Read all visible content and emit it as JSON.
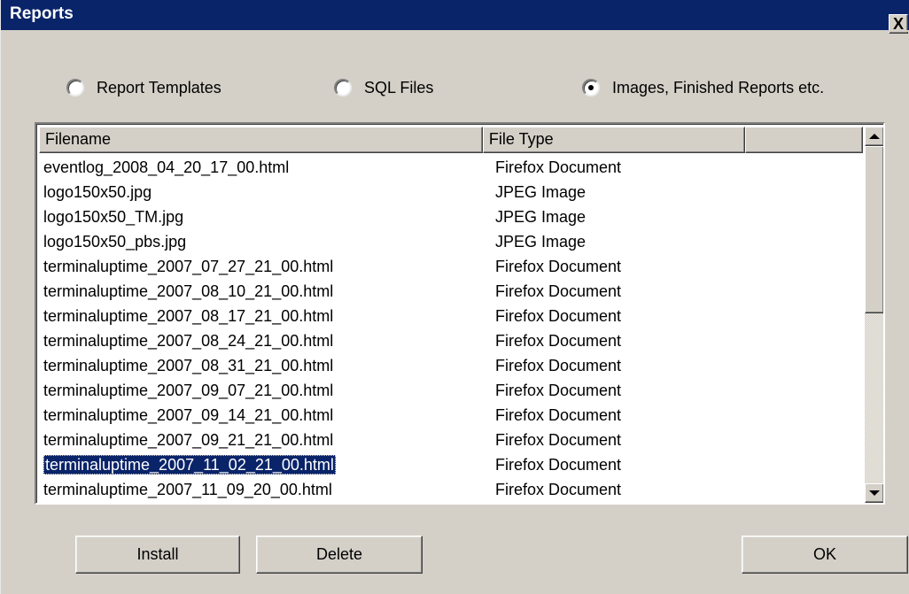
{
  "window": {
    "title": "Reports",
    "close_glyph": "X"
  },
  "radios": [
    {
      "label": "Report Templates",
      "checked": false
    },
    {
      "label": "SQL Files",
      "checked": false
    },
    {
      "label": "Images, Finished Reports etc.",
      "checked": true
    }
  ],
  "list": {
    "columns": [
      "Filename",
      "File Type",
      ""
    ],
    "rows": [
      {
        "name": "eventlog_2008_04_20_17_00.html",
        "type": "Firefox Document",
        "selected": false
      },
      {
        "name": "logo150x50.jpg",
        "type": "JPEG Image",
        "selected": false
      },
      {
        "name": "logo150x50_TM.jpg",
        "type": "JPEG Image",
        "selected": false
      },
      {
        "name": "logo150x50_pbs.jpg",
        "type": "JPEG Image",
        "selected": false
      },
      {
        "name": "terminaluptime_2007_07_27_21_00.html",
        "type": "Firefox Document",
        "selected": false
      },
      {
        "name": "terminaluptime_2007_08_10_21_00.html",
        "type": "Firefox Document",
        "selected": false
      },
      {
        "name": "terminaluptime_2007_08_17_21_00.html",
        "type": "Firefox Document",
        "selected": false
      },
      {
        "name": "terminaluptime_2007_08_24_21_00.html",
        "type": "Firefox Document",
        "selected": false
      },
      {
        "name": "terminaluptime_2007_08_31_21_00.html",
        "type": "Firefox Document",
        "selected": false
      },
      {
        "name": "terminaluptime_2007_09_07_21_00.html",
        "type": "Firefox Document",
        "selected": false
      },
      {
        "name": "terminaluptime_2007_09_14_21_00.html",
        "type": "Firefox Document",
        "selected": false
      },
      {
        "name": "terminaluptime_2007_09_21_21_00.html",
        "type": "Firefox Document",
        "selected": false
      },
      {
        "name": "terminaluptime_2007_11_02_21_00.html",
        "type": "Firefox Document",
        "selected": true
      },
      {
        "name": "terminaluptime_2007_11_09_20_00.html",
        "type": "Firefox Document",
        "selected": false
      }
    ]
  },
  "buttons": {
    "install": "Install",
    "delete": "Delete",
    "ok": "OK"
  },
  "colors": {
    "titlebar": "#0a246a",
    "face": "#d4d0c8",
    "selection": "#0a246a"
  }
}
